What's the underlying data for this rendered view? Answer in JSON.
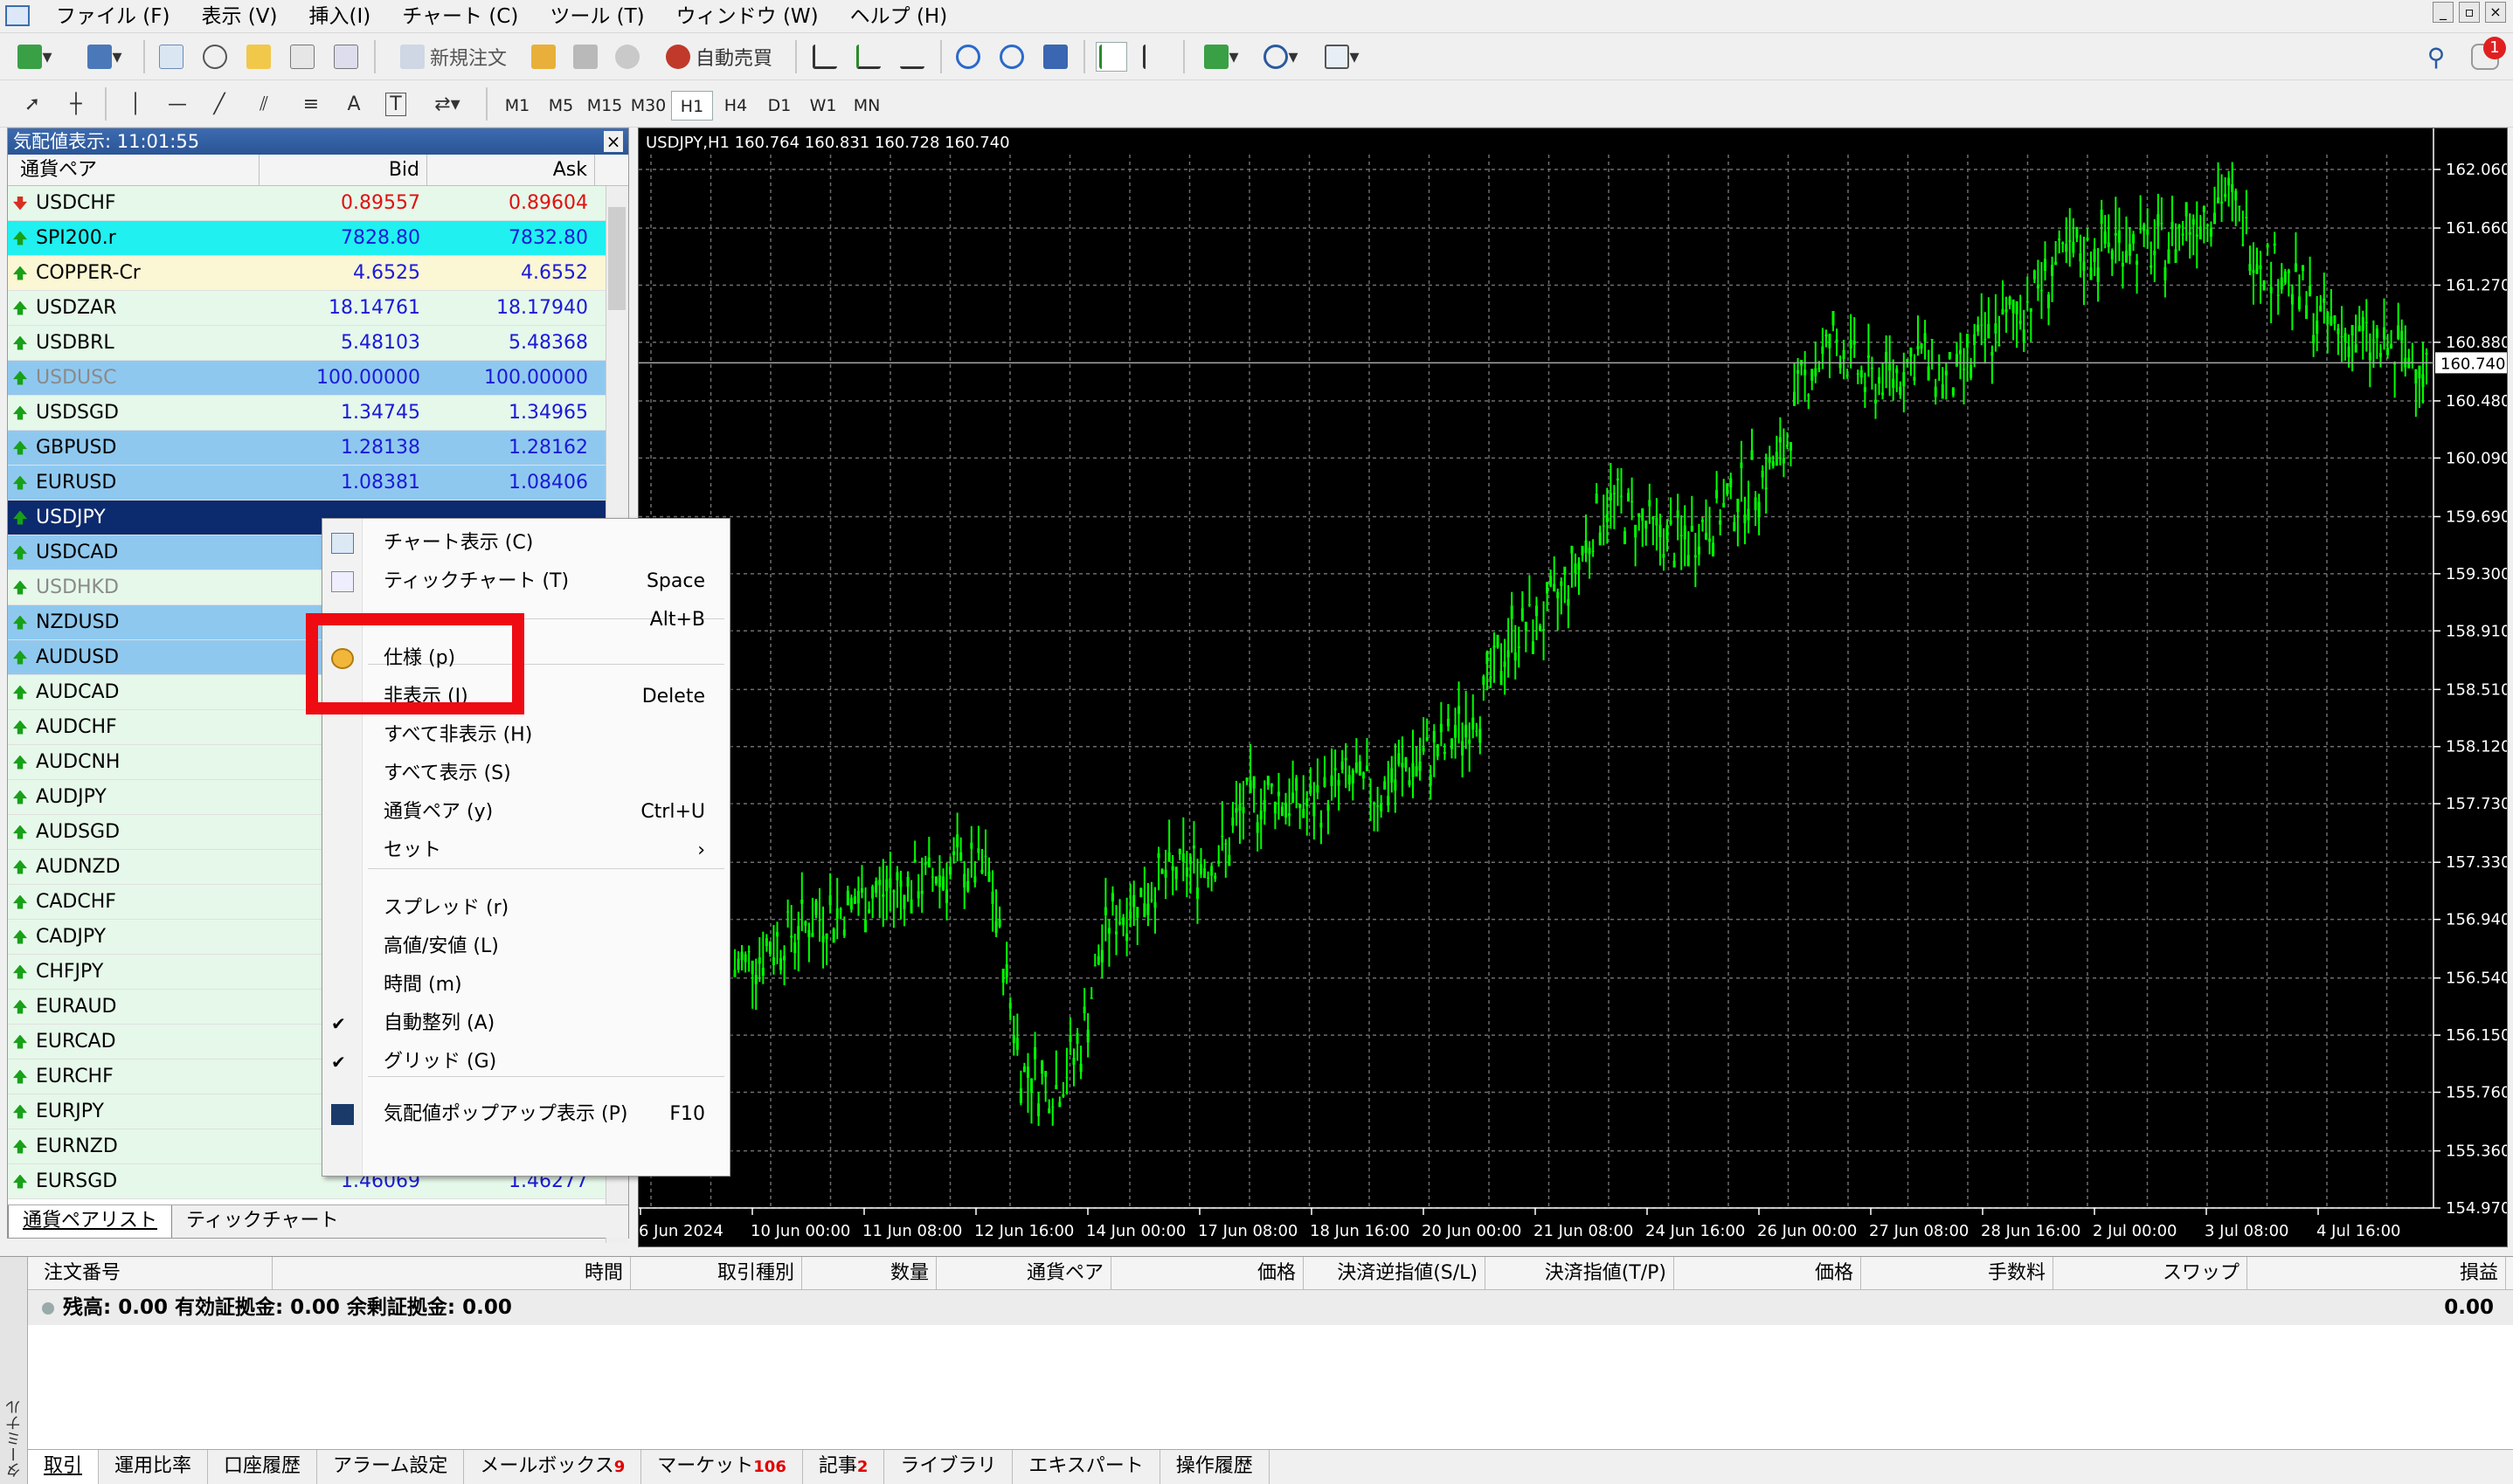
{
  "menubar": {
    "items": [
      "ファイル (F)",
      "表示 (V)",
      "挿入(I)",
      "チャート (C)",
      "ツール (T)",
      "ウィンドウ (W)",
      "ヘルプ (H)"
    ]
  },
  "toolbar": {
    "new_order": "新規注文",
    "auto_trade": "自動売買",
    "timeframes": [
      "M1",
      "M5",
      "M15",
      "M30",
      "H1",
      "H4",
      "D1",
      "W1",
      "MN"
    ],
    "active_timeframe": "H1",
    "notification_count": "1"
  },
  "market_watch": {
    "title": "気配値表示: 11:01:55",
    "close": "×",
    "col_symbol": "通貨ペア",
    "col_bid": "Bid",
    "col_ask": "Ask",
    "rows": [
      {
        "symbol": "USDCHF",
        "bid": "0.89557",
        "ask": "0.89604",
        "dir": "down",
        "style": "ltgreen",
        "color": "red"
      },
      {
        "symbol": "SPI200.r",
        "bid": "7828.80",
        "ask": "7832.80",
        "dir": "up",
        "style": "cyan",
        "color": "blue"
      },
      {
        "symbol": "COPPER-Cr",
        "bid": "4.6525",
        "ask": "4.6552",
        "dir": "up",
        "style": "yellow",
        "color": "blue"
      },
      {
        "symbol": "USDZAR",
        "bid": "18.14761",
        "ask": "18.17940",
        "dir": "up",
        "style": "ltgreen",
        "color": "blue"
      },
      {
        "symbol": "USDBRL",
        "bid": "5.48103",
        "ask": "5.48368",
        "dir": "up",
        "style": "ltgreen",
        "color": "blue"
      },
      {
        "symbol": "USDUSC",
        "bid": "100.00000",
        "ask": "100.00000",
        "dir": "up",
        "style": "blue",
        "color": "blue",
        "gray": true
      },
      {
        "symbol": "USDSGD",
        "bid": "1.34745",
        "ask": "1.34965",
        "dir": "up",
        "style": "ltgreen",
        "color": "blue"
      },
      {
        "symbol": "GBPUSD",
        "bid": "1.28138",
        "ask": "1.28162",
        "dir": "up",
        "style": "blue",
        "color": "blue"
      },
      {
        "symbol": "EURUSD",
        "bid": "1.08381",
        "ask": "1.08406",
        "dir": "up",
        "style": "blue",
        "color": "blue"
      },
      {
        "symbol": "USDJPY",
        "bid": "",
        "ask": "",
        "dir": "up",
        "style": "sel",
        "color": "blue"
      },
      {
        "symbol": "USDCAD",
        "bid": "",
        "ask": "",
        "dir": "up",
        "style": "blue",
        "color": "blue"
      },
      {
        "symbol": "USDHKD",
        "bid": "",
        "ask": "",
        "dir": "up",
        "style": "ltgreen",
        "color": "blue",
        "gray": true
      },
      {
        "symbol": "NZDUSD",
        "bid": "",
        "ask": "",
        "dir": "up",
        "style": "blue",
        "color": "blue"
      },
      {
        "symbol": "AUDUSD",
        "bid": "",
        "ask": "",
        "dir": "up",
        "style": "blue",
        "color": "blue"
      },
      {
        "symbol": "AUDCAD",
        "bid": "",
        "ask": "",
        "dir": "up",
        "style": "ltgreen",
        "color": "blue"
      },
      {
        "symbol": "AUDCHF",
        "bid": "",
        "ask": "",
        "dir": "up",
        "style": "ltgreen",
        "color": "blue"
      },
      {
        "symbol": "AUDCNH",
        "bid": "",
        "ask": "",
        "dir": "up",
        "style": "ltgreen",
        "color": "blue"
      },
      {
        "symbol": "AUDJPY",
        "bid": "",
        "ask": "",
        "dir": "up",
        "style": "ltgreen",
        "color": "blue"
      },
      {
        "symbol": "AUDSGD",
        "bid": "",
        "ask": "",
        "dir": "up",
        "style": "ltgreen",
        "color": "blue"
      },
      {
        "symbol": "AUDNZD",
        "bid": "",
        "ask": "",
        "dir": "up",
        "style": "ltgreen",
        "color": "blue"
      },
      {
        "symbol": "CADCHF",
        "bid": "",
        "ask": "",
        "dir": "up",
        "style": "ltgreen",
        "color": "blue"
      },
      {
        "symbol": "CADJPY",
        "bid": "",
        "ask": "",
        "dir": "up",
        "style": "ltgreen",
        "color": "blue"
      },
      {
        "symbol": "CHFJPY",
        "bid": "",
        "ask": "",
        "dir": "up",
        "style": "ltgreen",
        "color": "blue"
      },
      {
        "symbol": "EURAUD",
        "bid": "",
        "ask": "",
        "dir": "up",
        "style": "ltgreen",
        "color": "blue"
      },
      {
        "symbol": "EURCAD",
        "bid": "",
        "ask": "",
        "dir": "up",
        "style": "ltgreen",
        "color": "blue"
      },
      {
        "symbol": "EURCHF",
        "bid": "",
        "ask": "",
        "dir": "up",
        "style": "ltgreen",
        "color": "blue"
      },
      {
        "symbol": "EURJPY",
        "bid": "",
        "ask": "",
        "dir": "up",
        "style": "ltgreen",
        "color": "blue"
      },
      {
        "symbol": "EURNZD",
        "bid": "",
        "ask": "",
        "dir": "up",
        "style": "ltgreen",
        "color": "blue"
      },
      {
        "symbol": "EURSGD",
        "bid": "1.46069",
        "ask": "1.46277",
        "dir": "up",
        "style": "ltgreen",
        "color": "blue"
      }
    ],
    "tabs": [
      "通貨ペアリスト",
      "ティックチャート"
    ]
  },
  "context_menu": {
    "items": [
      {
        "label": "チャート表示 (C)",
        "shortcut": "",
        "icon": "chart-window-icon"
      },
      {
        "label": "ティックチャート (T)",
        "shortcut": "Space",
        "icon": "tick-chart-icon"
      },
      {
        "label": "",
        "shortcut": "Alt+B",
        "icon": ""
      },
      {
        "label": "仕様 (p)",
        "shortcut": "",
        "icon": "specification-coin-icon"
      },
      {
        "label": "非表示 (I)",
        "shortcut": "Delete",
        "icon": ""
      },
      {
        "label": "すべて非表示 (H)",
        "shortcut": "",
        "icon": ""
      },
      {
        "label": "すべて表示 (S)",
        "shortcut": "",
        "icon": ""
      },
      {
        "label": "通貨ペア (y)",
        "shortcut": "Ctrl+U",
        "icon": ""
      },
      {
        "label": "セット",
        "shortcut": "›",
        "icon": ""
      },
      {
        "label": "スプレッド (r)",
        "shortcut": "",
        "icon": ""
      },
      {
        "label": "高値/安値 (L)",
        "shortcut": "",
        "icon": ""
      },
      {
        "label": "時間 (m)",
        "shortcut": "",
        "icon": ""
      },
      {
        "label": "自動整列 (A)",
        "shortcut": "",
        "icon": "checkmark-icon"
      },
      {
        "label": "グリッド (G)",
        "shortcut": "",
        "icon": "checkmark-icon"
      },
      {
        "label": "気配値ポップアップ表示 (P)",
        "shortcut": "F10",
        "icon": "popup-prices-icon"
      }
    ]
  },
  "chart": {
    "header": "USDJPY,H1  160.764 160.831 160.728 160.740",
    "current_price": "160.740",
    "colors": {
      "background": "#000000",
      "candles": "#00ff00",
      "grid": "#6e6e6e"
    }
  },
  "chart_data": {
    "type": "line",
    "title": "USDJPY,H1",
    "y_ticks": [
      "162.060",
      "161.660",
      "161.270",
      "160.880",
      "160.480",
      "160.090",
      "159.690",
      "159.300",
      "158.910",
      "158.510",
      "158.120",
      "157.730",
      "157.330",
      "156.940",
      "156.540",
      "156.150",
      "155.760",
      "155.360",
      "154.970"
    ],
    "x_ticks": [
      "6 Jun 2024",
      "10 Jun 00:00",
      "11 Jun 08:00",
      "12 Jun 16:00",
      "14 Jun 00:00",
      "17 Jun 08:00",
      "18 Jun 16:00",
      "20 Jun 00:00",
      "21 Jun 08:00",
      "24 Jun 16:00",
      "26 Jun 00:00",
      "27 Jun 08:00",
      "28 Jun 16:00",
      "2 Jul 00:00",
      "3 Jul 08:00",
      "4 Jul 16:00"
    ],
    "ylim": [
      154.97,
      162.06
    ],
    "x": [
      0,
      0.04,
      0.08,
      0.11,
      0.13,
      0.15,
      0.17,
      0.19,
      0.205,
      0.21,
      0.22,
      0.25,
      0.27,
      0.29,
      0.3,
      0.32,
      0.34,
      0.36,
      0.38,
      0.4,
      0.42,
      0.44,
      0.46,
      0.48,
      0.5,
      0.51,
      0.52,
      0.54,
      0.56,
      0.58,
      0.6,
      0.62,
      0.63,
      0.65,
      0.67,
      0.69,
      0.7,
      0.72,
      0.74,
      0.76,
      0.78,
      0.8,
      0.82,
      0.84,
      0.86,
      0.88,
      0.9,
      0.92,
      0.94,
      0.96,
      0.98,
      1.0
    ],
    "values": [
      156.6,
      156.9,
      157.1,
      157.2,
      157.3,
      157.25,
      155.9,
      155.8,
      156.1,
      156.4,
      156.9,
      157.2,
      157.3,
      157.4,
      157.7,
      157.8,
      157.7,
      157.9,
      157.8,
      158.0,
      158.1,
      158.4,
      158.9,
      159.0,
      159.4,
      159.7,
      159.8,
      159.6,
      159.5,
      159.7,
      159.9,
      160.1,
      160.6,
      160.9,
      160.6,
      160.7,
      160.8,
      160.6,
      160.9,
      161.1,
      161.4,
      161.5,
      161.6,
      161.5,
      161.7,
      161.9,
      161.5,
      161.3,
      161.0,
      160.9,
      160.8,
      160.74
    ]
  },
  "terminal": {
    "side_label": "ターミナル",
    "columns": [
      "注文番号",
      "時間",
      "取引種別",
      "数量",
      "通貨ペア",
      "価格",
      "決済逆指値(S/L)",
      "決済指値(T/P)",
      "価格",
      "手数料",
      "スワップ",
      "損益"
    ],
    "balance_line": "残高: 0.00  有効証拠金: 0.00  余剰証拠金: 0.00",
    "balance_total": "0.00",
    "tabs": [
      {
        "label": "取引",
        "badge": ""
      },
      {
        "label": "運用比率",
        "badge": ""
      },
      {
        "label": "口座履歴",
        "badge": ""
      },
      {
        "label": "アラーム設定",
        "badge": ""
      },
      {
        "label": "メールボックス",
        "badge": "9"
      },
      {
        "label": "マーケット",
        "badge": "106"
      },
      {
        "label": "記事",
        "badge": "2"
      },
      {
        "label": "ライブラリ",
        "badge": ""
      },
      {
        "label": "エキスパート",
        "badge": ""
      },
      {
        "label": "操作履歴",
        "badge": ""
      }
    ]
  }
}
